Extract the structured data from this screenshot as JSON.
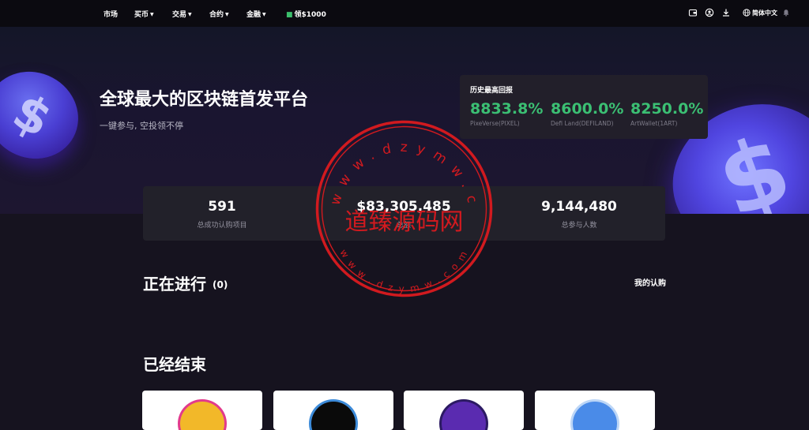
{
  "nav": {
    "items": [
      {
        "label": "市场",
        "dropdown": false
      },
      {
        "label": "买币",
        "dropdown": true
      },
      {
        "label": "交易",
        "dropdown": true
      },
      {
        "label": "合约",
        "dropdown": true
      },
      {
        "label": "金融",
        "dropdown": true
      }
    ],
    "promo": "领$1000",
    "language": "简体中文",
    "icons": [
      "wallet-icon",
      "user-icon",
      "download-icon",
      "globe-icon",
      "bell-icon"
    ]
  },
  "hero": {
    "title": "全球最大的区块链首发平台",
    "subtitle": "一键参与, 空投领不停"
  },
  "returns": {
    "title": "历史最高回报",
    "items": [
      {
        "value": "8833.8%",
        "name": "PixeVerse(PIXEL)"
      },
      {
        "value": "8600.0%",
        "name": "Defi Land(DEFILAND)"
      },
      {
        "value": "8250.0%",
        "name": "ArtWallet(1ART)"
      }
    ],
    "accent": "#3bbf73"
  },
  "stats": {
    "items": [
      {
        "value": "591",
        "label": "总成功认购项目"
      },
      {
        "value": "$83,305,485",
        "label": "总额"
      },
      {
        "value": "9,144,480",
        "label": "总参与人数"
      }
    ]
  },
  "ongoing": {
    "title": "正在进行",
    "count": "(0)",
    "my_subscriptions": "我的认购"
  },
  "ended": {
    "title": "已经结束",
    "cards": [
      {
        "logo_color": "#f2b829",
        "ring_color": "#e23a8c"
      },
      {
        "logo_color": "#0a0a0a",
        "ring_color": "#3d8bd9"
      },
      {
        "logo_color": "#5a2bb0",
        "ring_color": "#2c1a63"
      },
      {
        "logo_color": "#4a8be8",
        "ring_color": "#bcd6f7"
      }
    ]
  },
  "watermark": {
    "center_text": "道臻源码网",
    "ring_text": "www.dzymw.com"
  }
}
